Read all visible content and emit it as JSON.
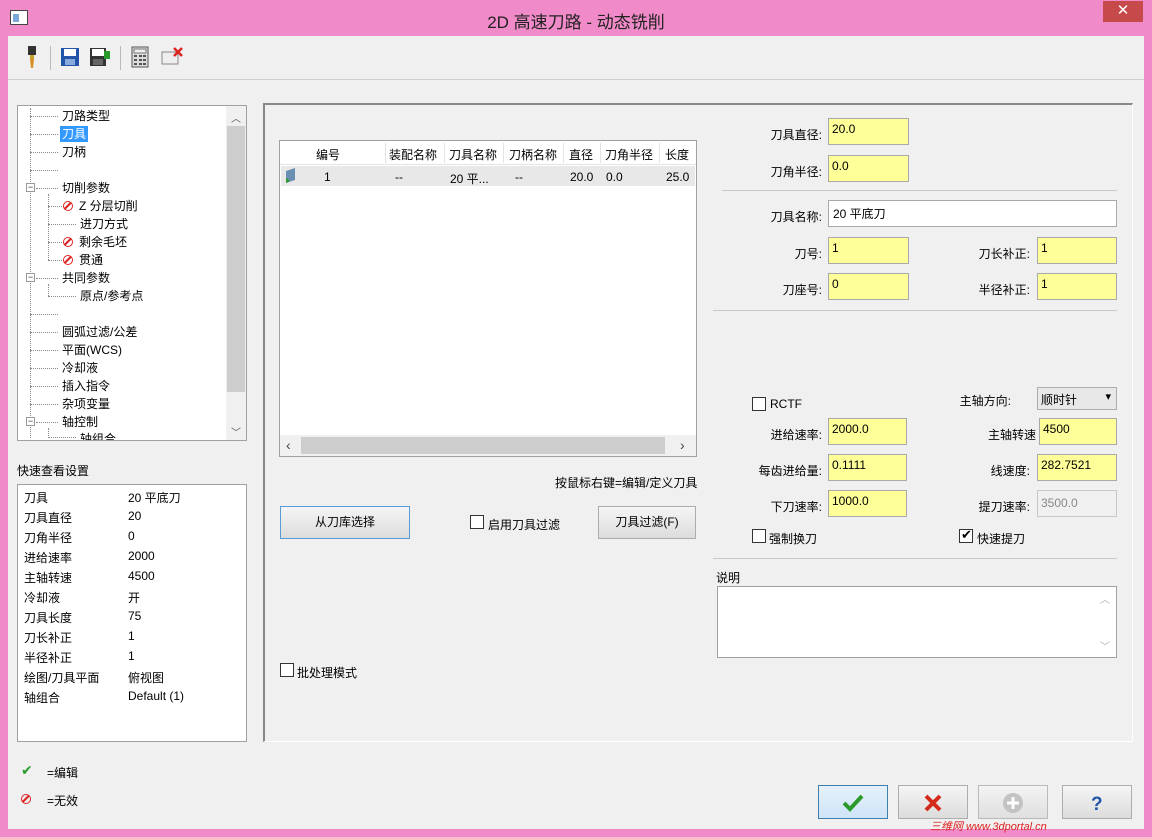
{
  "window": {
    "title": "2D 高速刀路 - 动态铣削",
    "close_glyph": "✕"
  },
  "toolbar": {
    "icons": [
      "tool-icon",
      "save-icon",
      "save-as-icon",
      "calculator-icon",
      "delete-icon"
    ]
  },
  "tree": {
    "items": [
      {
        "label": "刀路类型"
      },
      {
        "label": "刀具"
      },
      {
        "label": "刀柄"
      },
      {
        "label": "切削参数"
      },
      {
        "label": "Z 分层切削"
      },
      {
        "label": "进刀方式"
      },
      {
        "label": "剩余毛坯"
      },
      {
        "label": "贯通"
      },
      {
        "label": "共同参数"
      },
      {
        "label": "原点/参考点"
      },
      {
        "label": "圆弧过滤/公差"
      },
      {
        "label": "平面(WCS)"
      },
      {
        "label": "冷却液"
      },
      {
        "label": "插入指令"
      },
      {
        "label": "杂项变量"
      },
      {
        "label": "轴控制"
      },
      {
        "label": "轴组合"
      }
    ],
    "collapse_glyph": "−"
  },
  "quick_view": {
    "title": "快速查看设置",
    "rows": [
      {
        "label": "刀具",
        "value": "20 平底刀"
      },
      {
        "label": "刀具直径",
        "value": "20"
      },
      {
        "label": "刀角半径",
        "value": "0"
      },
      {
        "label": "进给速率",
        "value": "2000"
      },
      {
        "label": "主轴转速",
        "value": "4500"
      },
      {
        "label": "冷却液",
        "value": "开"
      },
      {
        "label": "刀具长度",
        "value": "75"
      },
      {
        "label": "刀长补正",
        "value": "1"
      },
      {
        "label": "半径补正",
        "value": "1"
      },
      {
        "label": "绘图/刀具平面",
        "value": "俯视图"
      },
      {
        "label": "轴组合",
        "value": "Default (1)"
      }
    ]
  },
  "legend": {
    "edit": "=编辑",
    "invalid": "=无效"
  },
  "tool_table": {
    "columns": [
      "编号",
      "装配名称",
      "刀具名称",
      "刀柄名称",
      "直径",
      "刀角半径",
      "长度"
    ],
    "rows": [
      {
        "num": "1",
        "assembly": "--",
        "name": "20 平...",
        "holder": "--",
        "dia": "20.0",
        "corner": "0.0",
        "length": "25.0"
      }
    ],
    "hint": "按鼠标右键=编辑/定义刀具"
  },
  "buttons": {
    "library": "从刀库选择",
    "filter_enable": "启用刀具过滤",
    "filter": "刀具过滤(F)",
    "batch": "批处理模式"
  },
  "fields": {
    "diameter_label": "刀具直径:",
    "diameter": "20.0",
    "corner_label": "刀角半径:",
    "corner": "0.0",
    "name_label": "刀具名称:",
    "name": "20 平底刀",
    "tool_num_label": "刀号:",
    "tool_num": "1",
    "length_offset_label": "刀长补正:",
    "length_offset": "1",
    "holder_num_label": "刀座号:",
    "holder_num": "0",
    "dia_offset_label": "半径补正:",
    "dia_offset": "1",
    "rctf_label": "RCTF",
    "spindle_dir_label": "主轴方向:",
    "spindle_dir": "顺时针",
    "feed_label": "进给速率:",
    "feed": "2000.0",
    "spindle_speed_label": "主轴转速",
    "spindle_speed": "4500",
    "fpt_label": "每齿进给量:",
    "fpt": "0.1111",
    "surface_speed_label": "线速度:",
    "surface_speed": "282.7521",
    "plunge_label": "下刀速率:",
    "plunge": "1000.0",
    "retract_label": "提刀速率:",
    "retract": "3500.0",
    "force_change_label": "强制换刀",
    "rapid_retract_label": "快速提刀",
    "comment_label": "说明"
  },
  "footer": {
    "watermark": "三维网 www.3dportal.cn"
  },
  "colors": {
    "title_bar": "#f08ac8",
    "field_yellow": "#ffff99",
    "selection": "#3399ff",
    "ok_green": "#2a9a2a",
    "cancel_red": "#d42a1a"
  }
}
